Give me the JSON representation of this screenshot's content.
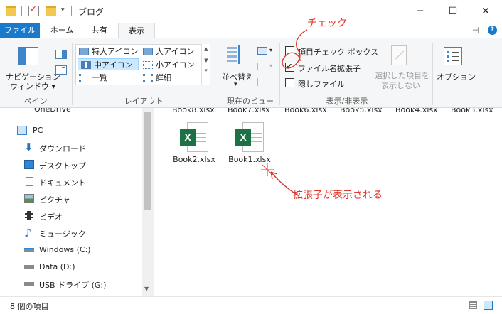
{
  "window": {
    "title": "ブログ",
    "minimize_glyph": "─",
    "maximize_glyph": "☐",
    "close_glyph": "✕"
  },
  "tabs": [
    {
      "label": "ファイル"
    },
    {
      "label": "ホーム"
    },
    {
      "label": "共有"
    },
    {
      "label": "表示"
    }
  ],
  "ribbon": {
    "pane_group": {
      "nav_pane_label_line1": "ナビゲーション",
      "nav_pane_label_line2": "ウィンドウ ▾",
      "group_label": "ペイン"
    },
    "layout_group": {
      "items": [
        {
          "label": "特大アイコン"
        },
        {
          "label": "大アイコン"
        },
        {
          "label": "中アイコン"
        },
        {
          "label": "小アイコン"
        },
        {
          "label": "一覧"
        },
        {
          "label": "詳細"
        }
      ],
      "group_label": "レイアウト"
    },
    "current_view_group": {
      "sort_label": "並べ替え",
      "group_label": "現在のビュー"
    },
    "show_hide_group": {
      "item_checkboxes": "項目チェック ボックス",
      "file_extensions": "ファイル名拡張子",
      "hidden_items": "隠しファイル",
      "hide_selected_line1": "選択した項目を",
      "hide_selected_line2": "表示しない",
      "group_label": "表示/非表示"
    },
    "options_label": "オプション"
  },
  "nav": {
    "partial_top": "OneDrive",
    "items": [
      {
        "label": "PC"
      },
      {
        "label": "ダウンロード"
      },
      {
        "label": "デスクトップ"
      },
      {
        "label": "ドキュメント"
      },
      {
        "label": "ピクチャ"
      },
      {
        "label": "ビデオ"
      },
      {
        "label": "ミュージック"
      },
      {
        "label": "Windows (C:)"
      },
      {
        "label": "Data (D:)"
      },
      {
        "label": "USB ドライブ (G:)"
      }
    ]
  },
  "content": {
    "cut_off_labels": [
      "Book8.xlsx",
      "Book7.xlsx",
      "Book6.xlsx",
      "Book5.xlsx",
      "Book4.xlsx",
      "Book3.xlsx"
    ],
    "files": [
      {
        "name": "Book2.xlsx"
      },
      {
        "name": "Book1.xlsx"
      }
    ]
  },
  "annotations": {
    "check": "チェック",
    "extension_shown": "拡張子が表示される"
  },
  "status": {
    "item_count": "8 個の項目"
  },
  "colors": {
    "accent": "#1979ca",
    "annotation": "#e0352b",
    "excel_green": "#1d7245"
  }
}
